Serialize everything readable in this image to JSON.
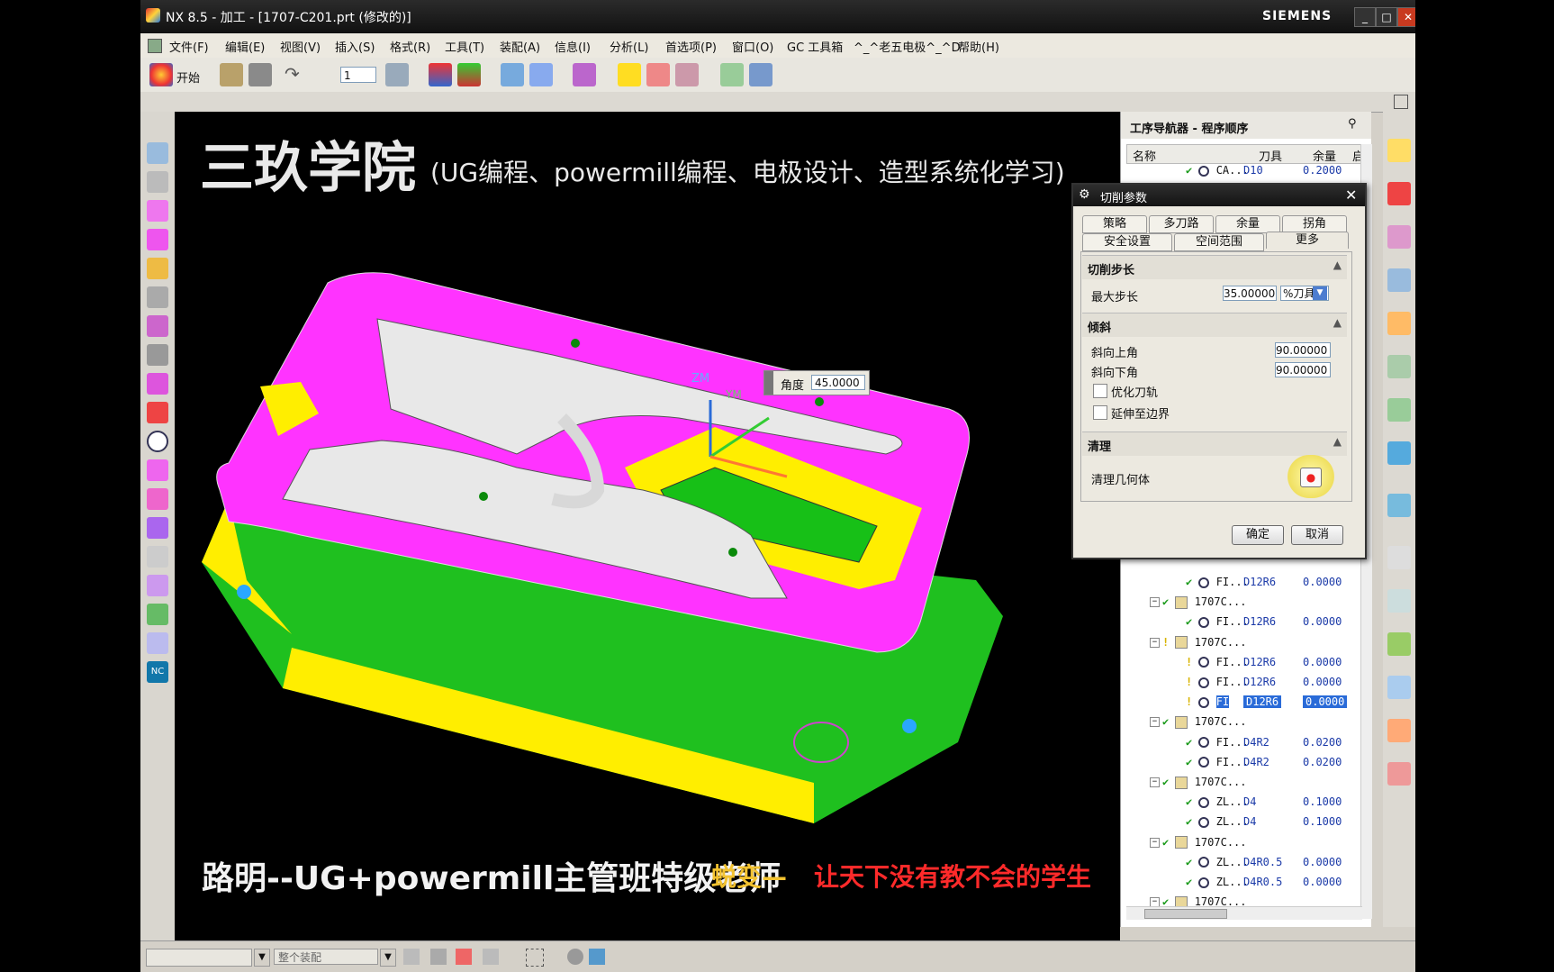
{
  "window": {
    "title": "NX 8.5 - 加工 - [1707-C201.prt (修改的)]",
    "brand": "SIEMENS"
  },
  "menubar": {
    "items": [
      "文件(F)",
      "编辑(E)",
      "视图(V)",
      "插入(S)",
      "格式(R)",
      "工具(T)",
      "装配(A)",
      "信息(I)",
      "分析(L)",
      "首选项(P)",
      "窗口(O)",
      "GC 工具箱",
      "^_^老五电极^_^D",
      "帮助(H)"
    ]
  },
  "toolbar": {
    "start_label": "开始",
    "layer_value": "1"
  },
  "overlay": {
    "title": "三玖学院",
    "subtitle": "(UG编程、powermill编程、电极设计、造型系统化学习)",
    "teacher": "路明--UG+powermill主管班特级老师",
    "slogan_a": "蜕变—",
    "slogan_b": "让天下没有教不会的学生"
  },
  "angle_popup": {
    "label": "角度",
    "value": "45.0000"
  },
  "navigator": {
    "header": "工序导航器 - 程序顺序",
    "col_name": "名称",
    "col_tool": "刀具",
    "col_stock": "余量",
    "col_more": "启",
    "top_row": {
      "name": "CA...",
      "tool": "D10",
      "stock": "0.2000"
    },
    "rows": [
      {
        "name": "FI...",
        "tool": "D12R6",
        "stock": "0.0000",
        "kind": "op",
        "status": "check"
      },
      {
        "name": "1707C...",
        "tool": "",
        "stock": "",
        "kind": "group",
        "status": "check"
      },
      {
        "name": "FI...",
        "tool": "D12R6",
        "stock": "0.0000",
        "kind": "op",
        "status": "check"
      },
      {
        "name": "1707C...",
        "tool": "",
        "stock": "",
        "kind": "group",
        "status": "warn"
      },
      {
        "name": "FI...",
        "tool": "D12R6",
        "stock": "0.0000",
        "kind": "op",
        "status": "warn"
      },
      {
        "name": "FI...",
        "tool": "D12R6",
        "stock": "0.0000",
        "kind": "op",
        "status": "warn"
      },
      {
        "name": "FI",
        "tool": "D12R6",
        "stock": "0.0000",
        "kind": "op",
        "status": "warn",
        "selected": true
      },
      {
        "name": "1707C...",
        "tool": "",
        "stock": "",
        "kind": "group",
        "status": "check"
      },
      {
        "name": "FI...",
        "tool": "D4R2",
        "stock": "0.0200",
        "kind": "op",
        "status": "check"
      },
      {
        "name": "FI...",
        "tool": "D4R2",
        "stock": "0.0200",
        "kind": "op",
        "status": "check"
      },
      {
        "name": "1707C...",
        "tool": "",
        "stock": "",
        "kind": "group",
        "status": "check"
      },
      {
        "name": "ZL...",
        "tool": "D4",
        "stock": "0.1000",
        "kind": "op",
        "status": "check"
      },
      {
        "name": "ZL...",
        "tool": "D4",
        "stock": "0.1000",
        "kind": "op",
        "status": "check"
      },
      {
        "name": "1707C...",
        "tool": "",
        "stock": "",
        "kind": "group",
        "status": "check"
      },
      {
        "name": "ZL...",
        "tool": "D4R0.5",
        "stock": "0.0000",
        "kind": "op",
        "status": "check"
      },
      {
        "name": "ZL...",
        "tool": "D4R0.5",
        "stock": "0.0000",
        "kind": "op",
        "status": "check"
      },
      {
        "name": "1707C...",
        "tool": "",
        "stock": "",
        "kind": "group",
        "status": "check"
      }
    ]
  },
  "dialog": {
    "title": "切削参数",
    "tabs_row1": [
      "策略",
      "多刀路",
      "余量",
      "拐角"
    ],
    "tabs_row2": [
      "安全设置",
      "空间范围",
      "更多"
    ],
    "section_step": "切削步长",
    "max_step_label": "最大步长",
    "max_step_value": "35.00000",
    "max_step_unit": "%刀具",
    "section_tilt": "倾斜",
    "tilt_up_label": "斜向上角",
    "tilt_up_value": "90.00000",
    "tilt_down_label": "斜向下角",
    "tilt_down_value": "90.00000",
    "opt_toolpath": "优化刀轨",
    "extend_boundary": "延伸至边界",
    "section_cleanup": "清理",
    "cleanup_geom": "清理几何体",
    "ok": "确定",
    "cancel": "取消"
  },
  "statusbar": {
    "filter_value": "整个装配"
  },
  "colors": {
    "magenta": "#ff33ff",
    "green": "#1fc01f",
    "yellow": "#ffee00",
    "selected": "#2a6bd8",
    "tool_blue": "#1b3aa8"
  }
}
